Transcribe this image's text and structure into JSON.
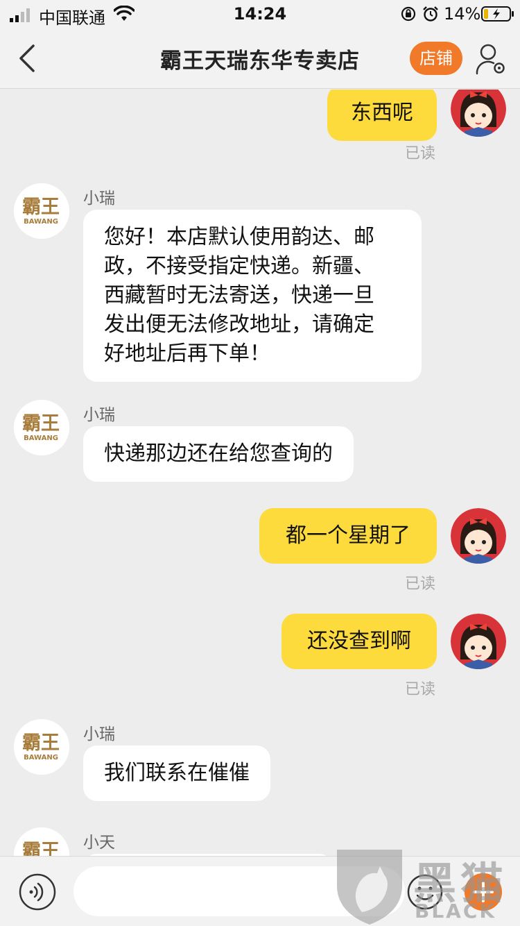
{
  "status_bar": {
    "carrier": "中国联通",
    "time": "14:24",
    "battery_percent": "14%",
    "icons": [
      "signal-icon",
      "wifi-icon",
      "rotation-lock-icon",
      "alarm-icon",
      "battery-charging-icon"
    ]
  },
  "header": {
    "title": "霸王天瑞东华专卖店",
    "shop_button": "店铺",
    "icons": [
      "back-icon",
      "user-settings-icon"
    ]
  },
  "shop_logo": {
    "cn": "霸王",
    "en": "BAWANG"
  },
  "messages": [
    {
      "side": "out",
      "text": "东西呢",
      "status": "已读"
    },
    {
      "side": "in",
      "sender": "小瑞",
      "lines": [
        "您好！本店默认使用韵达、邮",
        "政，不接受指定快递。新疆、",
        "西藏暂时无法寄送，快递一旦",
        "发出便无法修改地址，请确定",
        "好地址后再下单！"
      ]
    },
    {
      "side": "in",
      "sender": "小瑞",
      "text": "快递那边还在给您查询的"
    },
    {
      "side": "out",
      "text": "都一个星期了",
      "status": "已读"
    },
    {
      "side": "out",
      "text": "还没查到啊",
      "status": "已读"
    },
    {
      "side": "in",
      "sender": "小瑞",
      "text": "我们联系在催催"
    },
    {
      "side": "in",
      "sender": "小天"
    }
  ],
  "input_bar": {
    "placeholder": "",
    "icons": [
      "voice-icon",
      "emoji-icon",
      "plus-icon"
    ]
  },
  "watermark": {
    "title": "黑猫",
    "subtitle": "BLACK CAT"
  },
  "colors": {
    "outgoing_bubble": "#fedb3c",
    "incoming_bubble": "#ffffff",
    "accent": "#f07a2a",
    "background": "#ededed"
  }
}
